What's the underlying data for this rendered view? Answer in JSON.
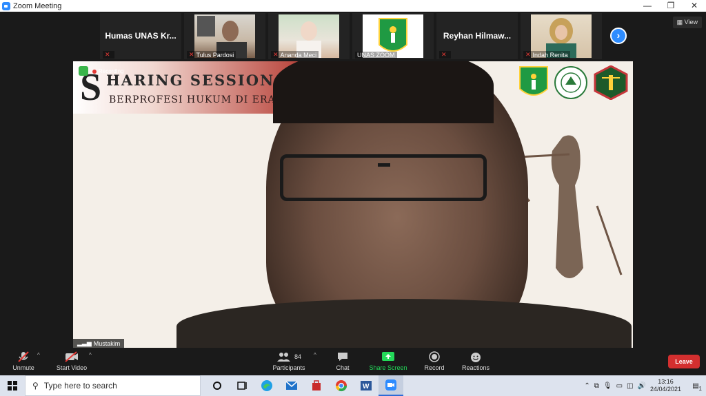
{
  "window": {
    "title": "Zoom Meeting",
    "minimize": "—",
    "maximize": "❐",
    "close": "✕"
  },
  "view_button": "View",
  "gallery": [
    {
      "name": "Humas UNAS Kr...",
      "label": ""
    },
    {
      "name": "",
      "label": "Tulus Pardosi"
    },
    {
      "name": "",
      "label": "Ananda Meci"
    },
    {
      "name": "",
      "label": "UNAS ZOOM"
    },
    {
      "name": "Reyhan Hilmaw...",
      "label": ""
    },
    {
      "name": "",
      "label": "Indah Renita"
    }
  ],
  "main_video": {
    "recording_label": "Recording",
    "banner": {
      "letter": "S",
      "title": "HARING SESSION",
      "subtitle": "BERPROFESI HUKUM DI ERA RE"
    },
    "speaker_name": "Mustakim"
  },
  "toolbar": {
    "unmute": "Unmute",
    "start_video": "Start Video",
    "participants_count": "84",
    "participants": "Participants",
    "chat": "Chat",
    "share_screen": "Share Screen",
    "record": "Record",
    "reactions": "Reactions",
    "leave": "Leave"
  },
  "taskbar": {
    "search_placeholder": "Type here to search",
    "time": "13:16",
    "date": "24/04/2021",
    "notifications": "1"
  },
  "colors": {
    "accent": "#2d8cff",
    "share_green": "#23d959",
    "leave_red": "#d32f2f",
    "mute_red": "#e53935"
  }
}
